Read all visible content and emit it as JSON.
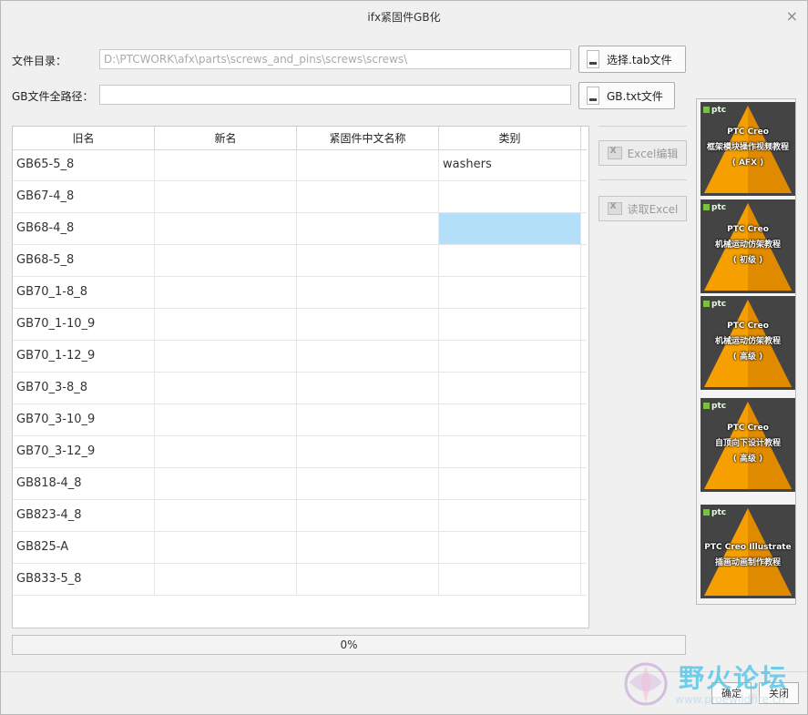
{
  "window": {
    "title": "ifx紧固件GB化",
    "close_symbol": "×"
  },
  "form": {
    "dir_label": "文件目录：",
    "dir_value": "D:\\PTCWORK\\afx\\parts\\screws_and_pins\\screws\\screws\\",
    "gb_label": "GB文件全路径：",
    "gb_value": "",
    "select_tab_button": "选择.tab文件",
    "gb_txt_button": "GB.txt文件"
  },
  "table": {
    "columns": [
      "旧名",
      "新名",
      "紧固件中文名称",
      "类别"
    ],
    "rows": [
      [
        "GB65-5_8",
        "",
        "",
        "washers"
      ],
      [
        "GB67-4_8",
        "",
        "",
        ""
      ],
      [
        "GB68-4_8",
        "",
        "",
        ""
      ],
      [
        "GB68-5_8",
        "",
        "",
        ""
      ],
      [
        "GB70_1-8_8",
        "",
        "",
        ""
      ],
      [
        "GB70_1-10_9",
        "",
        "",
        ""
      ],
      [
        "GB70_1-12_9",
        "",
        "",
        ""
      ],
      [
        "GB70_3-8_8",
        "",
        "",
        ""
      ],
      [
        "GB70_3-10_9",
        "",
        "",
        ""
      ],
      [
        "GB70_3-12_9",
        "",
        "",
        ""
      ],
      [
        "GB818-4_8",
        "",
        "",
        ""
      ],
      [
        "GB823-4_8",
        "",
        "",
        ""
      ],
      [
        "GB825-A",
        "",
        "",
        ""
      ],
      [
        "GB833-5_8",
        "",
        "",
        ""
      ]
    ],
    "selected_row": 2,
    "selected_col": 3
  },
  "side": {
    "excel_edit": "Excel编辑",
    "read_excel": "读取Excel"
  },
  "ads": [
    {
      "logo": "ptc",
      "lines": [
        "PTC Creo",
        "框架模块操作视频教程",
        "( AFX )"
      ]
    },
    {
      "logo": "ptc",
      "lines": [
        "PTC Creo",
        "机械运动仿架教程",
        "( 初级 )"
      ]
    },
    {
      "logo": "ptc",
      "lines": [
        "PTC Creo",
        "机械运动仿架教程",
        "( 高级 )"
      ]
    },
    {
      "logo": "ptc",
      "lines": [
        "PTC Creo",
        "自顶向下设计教程",
        "( 高级 )"
      ]
    },
    {
      "logo": "ptc",
      "lines": [
        "PTC Creo Illustrate",
        "插画动画制作教程"
      ]
    }
  ],
  "progress": {
    "value": 0,
    "label": "0%"
  },
  "footer": {
    "ok": "确定",
    "close": "关闭"
  },
  "watermark": {
    "text": "野火论坛",
    "url": "www.proewildfire.cn"
  },
  "colors": {
    "selection": "#b3dff8",
    "progress": "#06b025",
    "pyramid": "#f5a000"
  }
}
